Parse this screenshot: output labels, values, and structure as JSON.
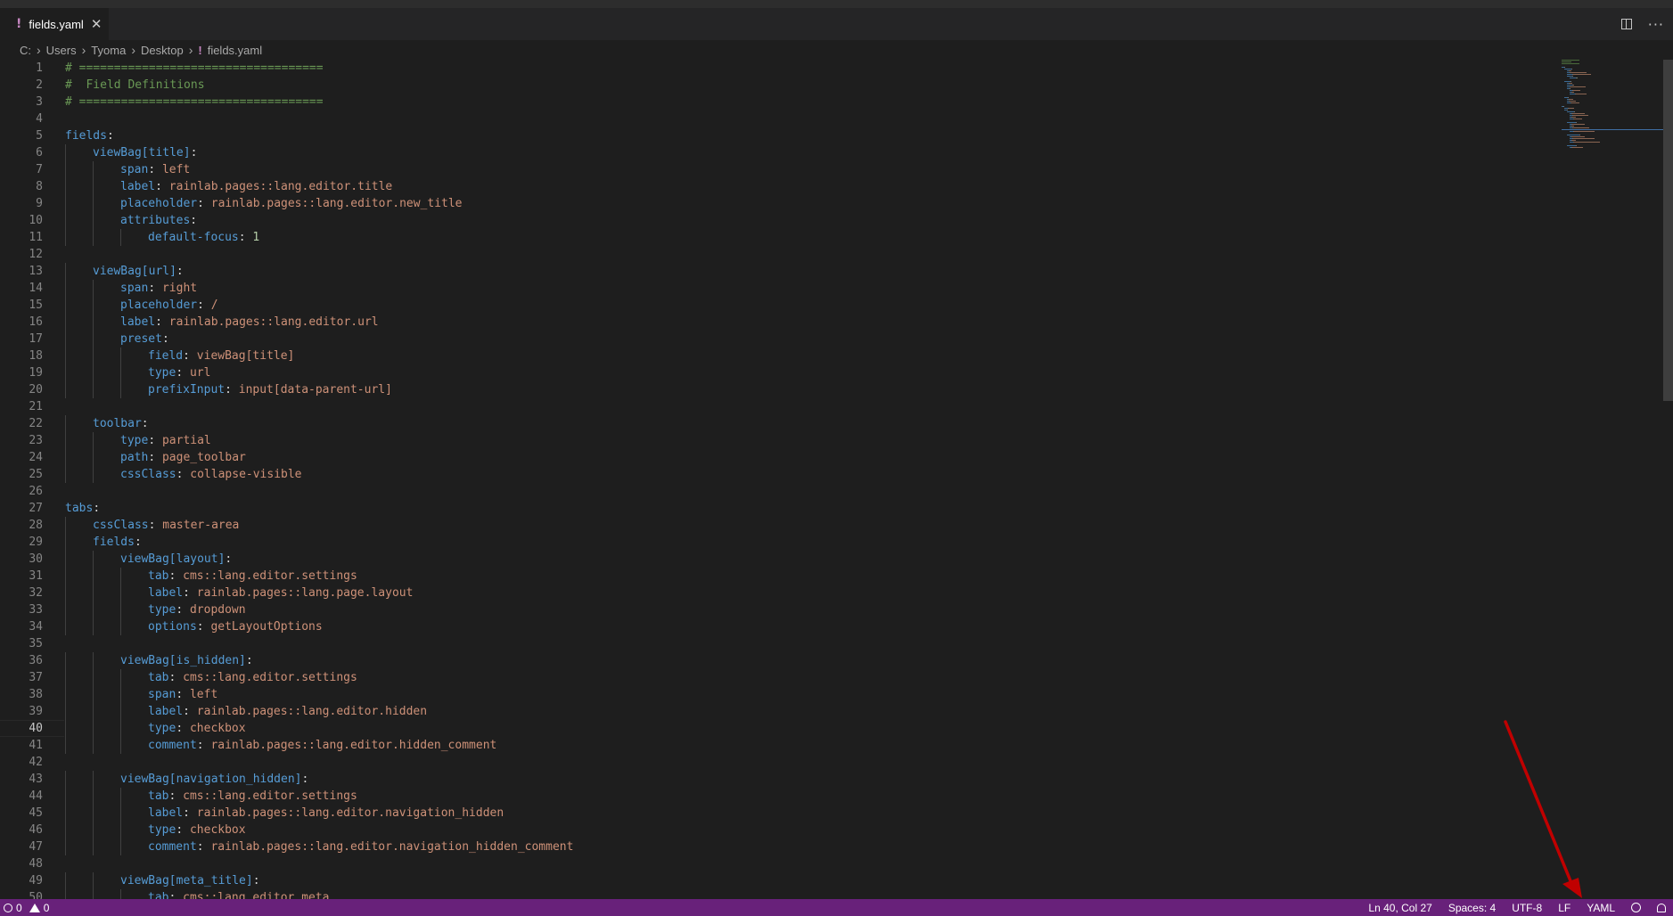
{
  "tab": {
    "icon": "!",
    "title": "fields.yaml",
    "close": "✕"
  },
  "tab_actions": {
    "split": "split-editor-icon",
    "more": "···"
  },
  "breadcrumb": [
    "C:",
    "Users",
    "Tyoma",
    "Desktop",
    "fields.yaml"
  ],
  "editor": {
    "active_line": 40,
    "lines": [
      {
        "n": "1",
        "indent": 0,
        "tokens": [
          [
            "c",
            "# ==================================="
          ]
        ]
      },
      {
        "n": "2",
        "indent": 0,
        "tokens": [
          [
            "c",
            "#  Field Definitions"
          ]
        ]
      },
      {
        "n": "3",
        "indent": 0,
        "tokens": [
          [
            "c",
            "# ==================================="
          ]
        ]
      },
      {
        "n": "4",
        "indent": 0,
        "tokens": []
      },
      {
        "n": "5",
        "indent": 0,
        "tokens": [
          [
            "k",
            "fields"
          ],
          [
            "p",
            ":"
          ]
        ]
      },
      {
        "n": "6",
        "indent": 1,
        "tokens": [
          [
            "k",
            "viewBag[title]"
          ],
          [
            "p",
            ":"
          ]
        ]
      },
      {
        "n": "7",
        "indent": 2,
        "tokens": [
          [
            "k",
            "span"
          ],
          [
            "p",
            ": "
          ],
          [
            "s",
            "left"
          ]
        ]
      },
      {
        "n": "8",
        "indent": 2,
        "tokens": [
          [
            "k",
            "label"
          ],
          [
            "p",
            ": "
          ],
          [
            "s",
            "rainlab.pages::lang.editor.title"
          ]
        ]
      },
      {
        "n": "9",
        "indent": 2,
        "tokens": [
          [
            "k",
            "placeholder"
          ],
          [
            "p",
            ": "
          ],
          [
            "s",
            "rainlab.pages::lang.editor.new_title"
          ]
        ]
      },
      {
        "n": "10",
        "indent": 2,
        "tokens": [
          [
            "k",
            "attributes"
          ],
          [
            "p",
            ":"
          ]
        ]
      },
      {
        "n": "11",
        "indent": 3,
        "tokens": [
          [
            "k",
            "default-focus"
          ],
          [
            "p",
            ": "
          ],
          [
            "n",
            "1"
          ]
        ]
      },
      {
        "n": "12",
        "indent": 0,
        "tokens": []
      },
      {
        "n": "13",
        "indent": 1,
        "tokens": [
          [
            "k",
            "viewBag[url]"
          ],
          [
            "p",
            ":"
          ]
        ]
      },
      {
        "n": "14",
        "indent": 2,
        "tokens": [
          [
            "k",
            "span"
          ],
          [
            "p",
            ": "
          ],
          [
            "s",
            "right"
          ]
        ]
      },
      {
        "n": "15",
        "indent": 2,
        "tokens": [
          [
            "k",
            "placeholder"
          ],
          [
            "p",
            ": "
          ],
          [
            "s",
            "/"
          ]
        ]
      },
      {
        "n": "16",
        "indent": 2,
        "tokens": [
          [
            "k",
            "label"
          ],
          [
            "p",
            ": "
          ],
          [
            "s",
            "rainlab.pages::lang.editor.url"
          ]
        ]
      },
      {
        "n": "17",
        "indent": 2,
        "tokens": [
          [
            "k",
            "preset"
          ],
          [
            "p",
            ":"
          ]
        ]
      },
      {
        "n": "18",
        "indent": 3,
        "tokens": [
          [
            "k",
            "field"
          ],
          [
            "p",
            ": "
          ],
          [
            "s",
            "viewBag[title]"
          ]
        ]
      },
      {
        "n": "19",
        "indent": 3,
        "tokens": [
          [
            "k",
            "type"
          ],
          [
            "p",
            ": "
          ],
          [
            "s",
            "url"
          ]
        ]
      },
      {
        "n": "20",
        "indent": 3,
        "tokens": [
          [
            "k",
            "prefixInput"
          ],
          [
            "p",
            ": "
          ],
          [
            "s",
            "input[data-parent-url]"
          ]
        ]
      },
      {
        "n": "21",
        "indent": 0,
        "tokens": []
      },
      {
        "n": "22",
        "indent": 1,
        "tokens": [
          [
            "k",
            "toolbar"
          ],
          [
            "p",
            ":"
          ]
        ]
      },
      {
        "n": "23",
        "indent": 2,
        "tokens": [
          [
            "k",
            "type"
          ],
          [
            "p",
            ": "
          ],
          [
            "s",
            "partial"
          ]
        ]
      },
      {
        "n": "24",
        "indent": 2,
        "tokens": [
          [
            "k",
            "path"
          ],
          [
            "p",
            ": "
          ],
          [
            "s",
            "page_toolbar"
          ]
        ]
      },
      {
        "n": "25",
        "indent": 2,
        "tokens": [
          [
            "k",
            "cssClass"
          ],
          [
            "p",
            ": "
          ],
          [
            "s",
            "collapse-visible"
          ]
        ]
      },
      {
        "n": "26",
        "indent": 0,
        "tokens": []
      },
      {
        "n": "27",
        "indent": 0,
        "tokens": [
          [
            "k",
            "tabs"
          ],
          [
            "p",
            ":"
          ]
        ]
      },
      {
        "n": "28",
        "indent": 1,
        "tokens": [
          [
            "k",
            "cssClass"
          ],
          [
            "p",
            ": "
          ],
          [
            "s",
            "master-area"
          ]
        ]
      },
      {
        "n": "29",
        "indent": 1,
        "tokens": [
          [
            "k",
            "fields"
          ],
          [
            "p",
            ":"
          ]
        ]
      },
      {
        "n": "30",
        "indent": 2,
        "tokens": [
          [
            "k",
            "viewBag[layout]"
          ],
          [
            "p",
            ":"
          ]
        ]
      },
      {
        "n": "31",
        "indent": 3,
        "tokens": [
          [
            "k",
            "tab"
          ],
          [
            "p",
            ": "
          ],
          [
            "s",
            "cms::lang.editor.settings"
          ]
        ]
      },
      {
        "n": "32",
        "indent": 3,
        "tokens": [
          [
            "k",
            "label"
          ],
          [
            "p",
            ": "
          ],
          [
            "s",
            "rainlab.pages::lang.page.layout"
          ]
        ]
      },
      {
        "n": "33",
        "indent": 3,
        "tokens": [
          [
            "k",
            "type"
          ],
          [
            "p",
            ": "
          ],
          [
            "s",
            "dropdown"
          ]
        ]
      },
      {
        "n": "34",
        "indent": 3,
        "tokens": [
          [
            "k",
            "options"
          ],
          [
            "p",
            ": "
          ],
          [
            "s",
            "getLayoutOptions"
          ]
        ]
      },
      {
        "n": "35",
        "indent": 0,
        "tokens": []
      },
      {
        "n": "36",
        "indent": 2,
        "tokens": [
          [
            "k",
            "viewBag[is_hidden]"
          ],
          [
            "p",
            ":"
          ]
        ]
      },
      {
        "n": "37",
        "indent": 3,
        "tokens": [
          [
            "k",
            "tab"
          ],
          [
            "p",
            ": "
          ],
          [
            "s",
            "cms::lang.editor.settings"
          ]
        ]
      },
      {
        "n": "38",
        "indent": 3,
        "tokens": [
          [
            "k",
            "span"
          ],
          [
            "p",
            ": "
          ],
          [
            "s",
            "left"
          ]
        ]
      },
      {
        "n": "39",
        "indent": 3,
        "tokens": [
          [
            "k",
            "label"
          ],
          [
            "p",
            ": "
          ],
          [
            "s",
            "rainlab.pages::lang.editor.hidden"
          ]
        ]
      },
      {
        "n": "40",
        "indent": 3,
        "tokens": [
          [
            "k",
            "type"
          ],
          [
            "p",
            ": "
          ],
          [
            "s",
            "checkbox"
          ]
        ]
      },
      {
        "n": "41",
        "indent": 3,
        "tokens": [
          [
            "k",
            "comment"
          ],
          [
            "p",
            ": "
          ],
          [
            "s",
            "rainlab.pages::lang.editor.hidden_comment"
          ]
        ]
      },
      {
        "n": "42",
        "indent": 0,
        "tokens": []
      },
      {
        "n": "43",
        "indent": 2,
        "tokens": [
          [
            "k",
            "viewBag[navigation_hidden]"
          ],
          [
            "p",
            ":"
          ]
        ]
      },
      {
        "n": "44",
        "indent": 3,
        "tokens": [
          [
            "k",
            "tab"
          ],
          [
            "p",
            ": "
          ],
          [
            "s",
            "cms::lang.editor.settings"
          ]
        ]
      },
      {
        "n": "45",
        "indent": 3,
        "tokens": [
          [
            "k",
            "label"
          ],
          [
            "p",
            ": "
          ],
          [
            "s",
            "rainlab.pages::lang.editor.navigation_hidden"
          ]
        ]
      },
      {
        "n": "46",
        "indent": 3,
        "tokens": [
          [
            "k",
            "type"
          ],
          [
            "p",
            ": "
          ],
          [
            "s",
            "checkbox"
          ]
        ]
      },
      {
        "n": "47",
        "indent": 3,
        "tokens": [
          [
            "k",
            "comment"
          ],
          [
            "p",
            ": "
          ],
          [
            "s",
            "rainlab.pages::lang.editor.navigation_hidden_comment"
          ]
        ]
      },
      {
        "n": "48",
        "indent": 0,
        "tokens": []
      },
      {
        "n": "49",
        "indent": 2,
        "tokens": [
          [
            "k",
            "viewBag[meta_title]"
          ],
          [
            "p",
            ":"
          ]
        ]
      },
      {
        "n": "50",
        "indent": 3,
        "tokens": [
          [
            "k",
            "tab"
          ],
          [
            "p",
            ": "
          ],
          [
            "s",
            "cms::lang.editor.meta"
          ]
        ]
      }
    ]
  },
  "statusbar": {
    "errors": "0",
    "warnings": "0",
    "position": "Ln 40, Col 27",
    "spaces": "Spaces: 4",
    "encoding": "UTF-8",
    "eol": "LF",
    "language": "YAML"
  },
  "colors": {
    "statusbar_bg": "#68217a",
    "editor_bg": "#1e1e1e",
    "key": "#569cd6",
    "string": "#ce9178",
    "comment": "#6a9955",
    "number": "#b5cea8",
    "annotation_arrow": "#c00000"
  }
}
